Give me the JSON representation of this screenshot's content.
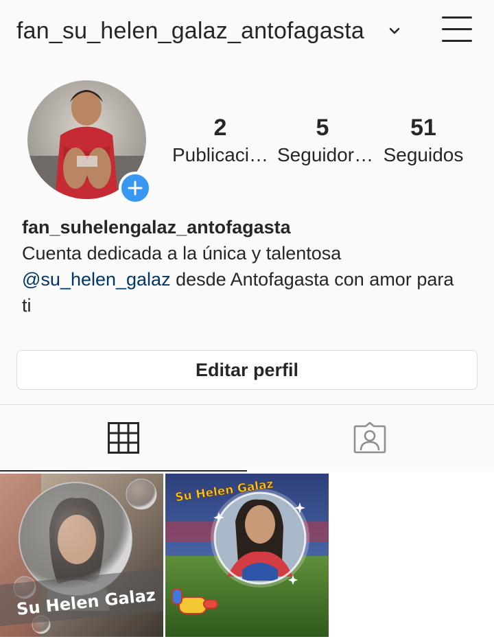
{
  "header": {
    "username": "fan_su_helen_galaz_antofagasta",
    "dropdown_icon": "chevron-down-icon",
    "menu_icon": "hamburger-menu-icon"
  },
  "profile": {
    "add_story_icon": "plus-icon",
    "stats": [
      {
        "count": "2",
        "label": "Publicaci…"
      },
      {
        "count": "5",
        "label": "Seguidor…"
      },
      {
        "count": "51",
        "label": "Seguidos"
      }
    ],
    "bio": {
      "name": "fan_suhelengalaz_antofagasta",
      "line1": "Cuenta dedicada a la única y talentosa",
      "mention": "@su_helen_galaz",
      "line2_rest": " desde Antofagasta con amor para",
      "line3": "ti"
    },
    "edit_button": "Editar perfil"
  },
  "tabs": [
    {
      "icon": "grid-icon",
      "active": true
    },
    {
      "icon": "tagged-person-icon",
      "active": false
    }
  ],
  "posts": [
    {
      "overlay_text": "Su Helen Galaz"
    },
    {
      "overlay_text": "Su Helen Galaz"
    }
  ],
  "colors": {
    "accent_blue": "#3897f0",
    "mention_link": "#003569",
    "text": "#262626",
    "border": "#dbdbdb",
    "background": "#fafafa"
  }
}
